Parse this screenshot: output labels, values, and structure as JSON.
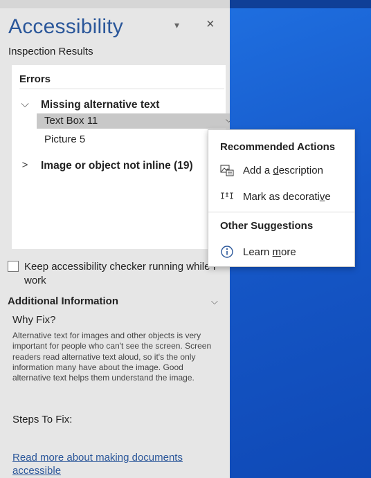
{
  "pane": {
    "title": "Accessibility",
    "menu_icon": "dropdown-caret-icon",
    "close_icon": "close-icon",
    "subtitle": "Inspection Results"
  },
  "results": {
    "errors_heading": "Errors",
    "groups": [
      {
        "label": "Missing alternative text",
        "expanded": true,
        "items": [
          {
            "label": "Text Box 11",
            "selected": true
          },
          {
            "label": "Picture 5",
            "selected": false
          }
        ]
      },
      {
        "label": "Image or object not inline (19)",
        "expanded": false
      }
    ]
  },
  "context_menu": {
    "recommended_heading": "Recommended Actions",
    "add_description_pre": "Add a ",
    "add_description_key": "d",
    "add_description_post": "escription",
    "add_description_icon": "image-description-icon",
    "mark_decorative_pre": "Mark as decorati",
    "mark_decorative_key": "v",
    "mark_decorative_post": "e",
    "mark_decorative_icon": "decorative-icon",
    "other_heading": "Other Suggestions",
    "learn_more_pre": "Learn ",
    "learn_more_key": "m",
    "learn_more_post": "ore",
    "learn_more_icon": "info-icon"
  },
  "keep_checker": {
    "label": "Keep accessibility checker running while I work",
    "checked": false
  },
  "additional": {
    "heading": "Additional Information",
    "why_fix": "Why Fix?",
    "why_body": "Alternative text for images and other objects is very important for people who can't see the screen. Screen readers read alternative text aloud, so it's the only information many have about the image. Good alternative text helps them understand the image.",
    "steps_to_fix": "Steps To Fix:",
    "read_more_link": "Read more about making documents accessible"
  },
  "colors": {
    "title_blue": "#2b579a",
    "pane_bg": "#e6e6e6",
    "desktop_blue": "#1a5fc4",
    "selected_row": "#c8c8c8"
  }
}
